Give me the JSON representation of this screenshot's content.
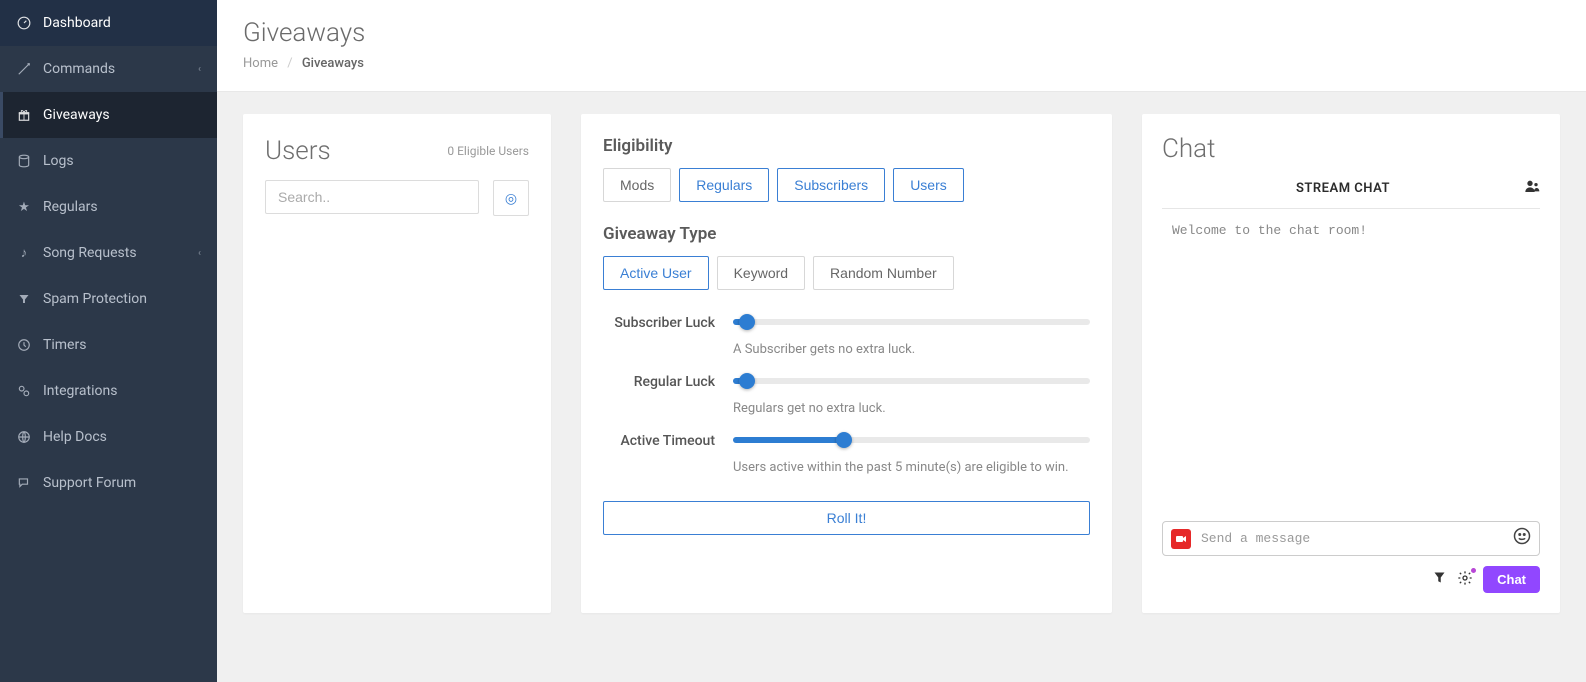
{
  "sidebar": {
    "items": [
      {
        "label": "Dashboard",
        "icon": "⌂"
      },
      {
        "label": "Commands",
        "icon": "✎",
        "expandable": true
      },
      {
        "label": "Giveaways",
        "icon": "★",
        "active": true
      },
      {
        "label": "Logs",
        "icon": "≣"
      },
      {
        "label": "Regulars",
        "icon": "☆"
      },
      {
        "label": "Song Requests",
        "icon": "♪",
        "expandable": true
      },
      {
        "label": "Spam Protection",
        "icon": "▼"
      },
      {
        "label": "Timers",
        "icon": "◷"
      },
      {
        "label": "Integrations",
        "icon": "⚙"
      },
      {
        "label": "Help Docs",
        "icon": "◍"
      },
      {
        "label": "Support Forum",
        "icon": "✉"
      }
    ]
  },
  "page": {
    "title": "Giveaways",
    "breadcrumb_home": "Home",
    "breadcrumb_current": "Giveaways"
  },
  "users_panel": {
    "title": "Users",
    "eligible_text": "0 Eligible Users",
    "search_placeholder": "Search.."
  },
  "eligibility": {
    "title": "Eligibility",
    "options": [
      "Mods",
      "Regulars",
      "Subscribers",
      "Users"
    ]
  },
  "giveaway_type": {
    "title": "Giveaway Type",
    "options": [
      "Active User",
      "Keyword",
      "Random Number"
    ]
  },
  "sliders": {
    "subscriber_luck": {
      "label": "Subscriber Luck",
      "help": "A Subscriber gets no extra luck.",
      "pct": 4
    },
    "regular_luck": {
      "label": "Regular Luck",
      "help": "Regulars get no extra luck.",
      "pct": 4
    },
    "active_timeout": {
      "label": "Active Timeout",
      "help": "Users active within the past 5 minute(s) are eligible to win.",
      "pct": 31
    }
  },
  "roll_label": "Roll It!",
  "chat": {
    "title": "Chat",
    "header": "STREAM CHAT",
    "welcome": "Welcome to the chat room!",
    "input_placeholder": "Send a message",
    "send_label": "Chat"
  }
}
